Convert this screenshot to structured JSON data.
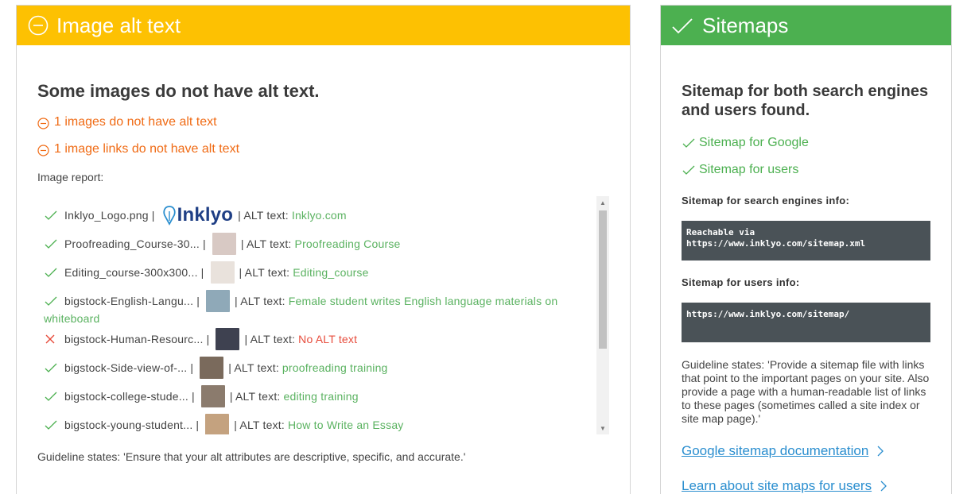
{
  "left_panel": {
    "title": "Image alt text",
    "headline": "Some images do not have alt text.",
    "warnings": [
      "1 images do not have alt text",
      "1 image links do not have alt text"
    ],
    "report_label": "Image report:",
    "alt_label": "| ALT text: ",
    "rows": [
      {
        "status": "ok",
        "file": "Inklyo_Logo.png",
        "alt": "Inklyo.com",
        "thumb": "logo"
      },
      {
        "status": "ok",
        "file": "Proofreading_Course-30...",
        "alt": "Proofreading Course",
        "thumb": "#d8c9c4"
      },
      {
        "status": "ok",
        "file": "Editing_course-300x300...",
        "alt": "Editing_course",
        "thumb": "#e9e2dc"
      },
      {
        "status": "ok",
        "file": "bigstock-English-Langu...",
        "alt": "Female student writes English language materials on",
        "alt_wrap": "whiteboard",
        "thumb": "#8fa9b8"
      },
      {
        "status": "bad",
        "file": "bigstock-Human-Resourc...",
        "alt": "No ALT text",
        "thumb": "#3e4150"
      },
      {
        "status": "ok",
        "file": "bigstock-Side-view-of-...",
        "alt": "proofreading training",
        "thumb": "#7a6a5c"
      },
      {
        "status": "ok",
        "file": "bigstock-college-stude...",
        "alt": "editing training",
        "thumb": "#8b7b6d"
      },
      {
        "status": "ok",
        "file": "bigstock-young-student...",
        "alt": "How to Write an Essay",
        "thumb": "#c4a27f"
      }
    ],
    "logo_text": "Inklyo",
    "guideline": "Guideline states: 'Ensure that your alt attributes are descriptive, specific, and accurate.'"
  },
  "right_panel": {
    "title": "Sitemaps",
    "headline": "Sitemap for both search engines and users found.",
    "checks": [
      "Sitemap for Google",
      "Sitemap for users"
    ],
    "engines_label": "Sitemap for search engines info:",
    "engines_code_line1": "Reachable via",
    "engines_code_line2": "https://www.inklyo.com/sitemap.xml",
    "users_label": "Sitemap for users info:",
    "users_code": "https://www.inklyo.com/sitemap/",
    "guideline": "Guideline states: 'Provide a sitemap file with links that point to the important pages on your site. Also provide a page with a human-readable list of links to these pages (sometimes called a site index or site map page).'",
    "links": [
      "Google sitemap documentation",
      "Learn about site maps for users"
    ]
  },
  "colors": {
    "warning_header": "#fdc102",
    "success_header": "#4cb050",
    "warning_text": "#f06b15",
    "ok_text": "#5ab260",
    "bad_text": "#e74c3c",
    "link": "#2a8ecf",
    "code_bg": "#4a5257"
  }
}
